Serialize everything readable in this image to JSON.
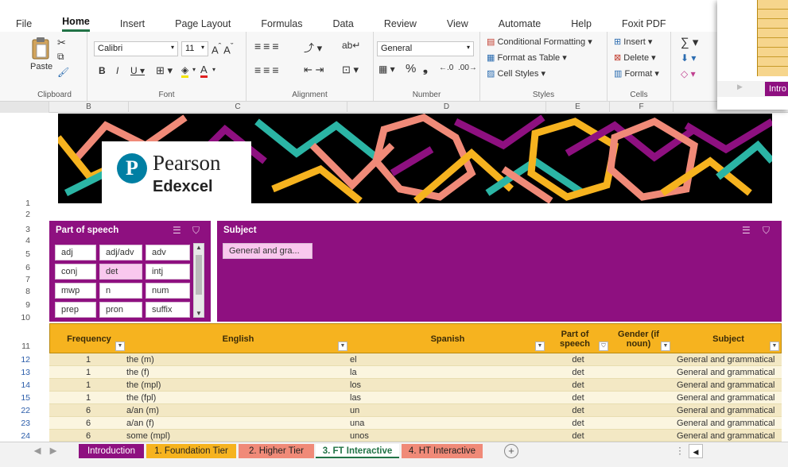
{
  "menu": [
    "File",
    "Home",
    "Insert",
    "Page Layout",
    "Formulas",
    "Data",
    "Review",
    "View",
    "Automate",
    "Help",
    "Foxit PDF"
  ],
  "ribbon": {
    "paste_label": "Paste",
    "clipboard_label": "Clipboard",
    "font_name": "Calibri",
    "font_size": "11",
    "font_label": "Font",
    "alignment_label": "Alignment",
    "number_format": "General",
    "number_label": "Number",
    "conditional_formatting": "Conditional Formatting",
    "format_as_table": "Format as Table",
    "cell_styles": "Cell Styles",
    "styles_label": "Styles",
    "insert": "Insert",
    "delete": "Delete",
    "format": "Format",
    "cells_label": "Cells"
  },
  "columns": [
    "B",
    "C",
    "D",
    "E",
    "F"
  ],
  "rows": [
    "1",
    "2",
    "3",
    "4",
    "5",
    "6",
    "7",
    "8",
    "9",
    "10",
    "11",
    "12",
    "13",
    "14",
    "15",
    "22",
    "23",
    "24"
  ],
  "logo": {
    "line1": "Pearson",
    "line2": "Edexcel"
  },
  "slicer_pos": {
    "title": "Part of speech",
    "items": [
      "adj",
      "adj/adv",
      "adv",
      "conj",
      "det",
      "intj",
      "mwp",
      "n",
      "num",
      "prep",
      "pron",
      "suffix"
    ],
    "selected": "det"
  },
  "slicer_subject": {
    "title": "Subject",
    "items": [
      "General and gra..."
    ]
  },
  "table": {
    "headers": [
      "Frequency",
      "English",
      "Spanish",
      "Part of speech",
      "Gender (if noun)",
      "Subject"
    ],
    "rows": [
      [
        "1",
        "the (m)",
        "el",
        "det",
        "",
        "General and grammatical"
      ],
      [
        "1",
        "the (f)",
        "la",
        "det",
        "",
        "General and grammatical"
      ],
      [
        "1",
        "the (mpl)",
        "los",
        "det",
        "",
        "General and grammatical"
      ],
      [
        "1",
        "the (fpl)",
        "las",
        "det",
        "",
        "General and grammatical"
      ],
      [
        "6",
        "a/an (m)",
        "un",
        "det",
        "",
        "General and grammatical"
      ],
      [
        "6",
        "a/an (f)",
        "una",
        "det",
        "",
        "General and grammatical"
      ],
      [
        "6",
        "some (mpl)",
        "unos",
        "det",
        "",
        "General and grammatical"
      ]
    ]
  },
  "sheet_tabs": [
    {
      "label": "Introduction",
      "color": "#8e1080",
      "text": "#ffffff"
    },
    {
      "label": "1. Foundation Tier",
      "color": "#f6b31f",
      "text": "#222222"
    },
    {
      "label": "2. Higher Tier",
      "color": "#f08a78",
      "text": "#222222"
    },
    {
      "label": "3. FT Interactive",
      "color": "#ffffff",
      "text": "#217346"
    },
    {
      "label": "4. HT Interactive",
      "color": "#f08a78",
      "text": "#222222"
    }
  ],
  "overlay_tab": "Intro",
  "colors": {
    "purple": "#8e1080",
    "gold": "#f6b31f",
    "coral": "#f08a78",
    "teal": "#2bb5a5",
    "excel_green": "#217346"
  },
  "icons": [
    "paste-icon",
    "cut-icon",
    "copy-icon",
    "format-painter-icon",
    "filter-icon",
    "multi-select-icon",
    "dropdown-icon",
    "new-sheet-icon"
  ]
}
